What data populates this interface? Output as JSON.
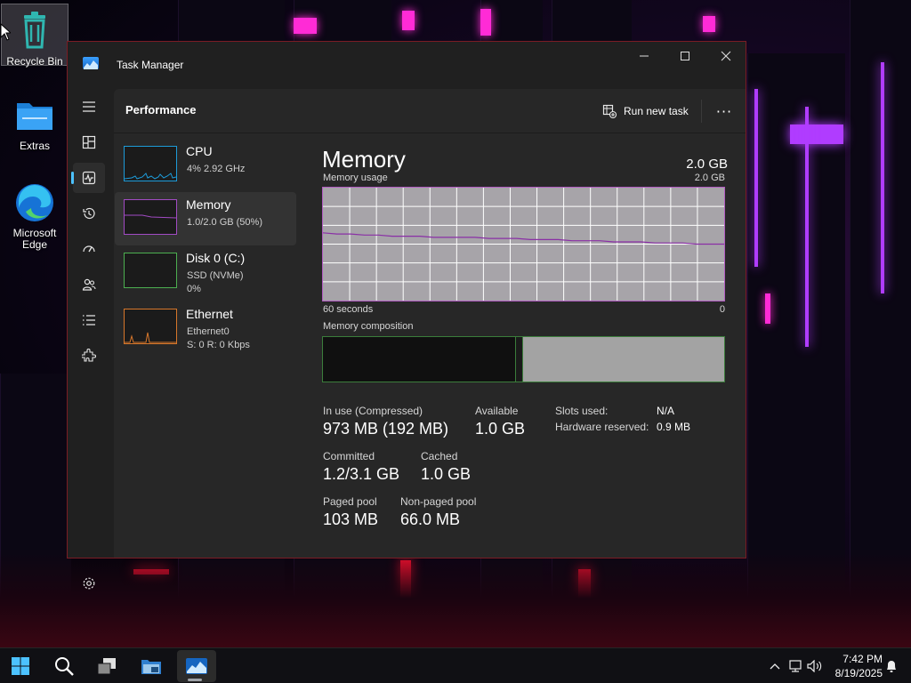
{
  "desktop": {
    "icons": [
      {
        "label": "Recycle Bin",
        "icon": "recycle-bin-icon"
      },
      {
        "label": "Extras",
        "icon": "folder-icon"
      },
      {
        "label": "Microsoft Edge",
        "icon": "edge-icon"
      }
    ]
  },
  "window": {
    "title": "Task Manager",
    "controls": {
      "minimize": "—",
      "maximize": "☐",
      "close": "✕"
    }
  },
  "header": {
    "page_title": "Performance",
    "run_new_task": "Run new task",
    "more": "···"
  },
  "rail": {
    "items": [
      "hamburger-icon",
      "processes-icon",
      "performance-icon",
      "app-history-icon",
      "startup-apps-icon",
      "users-icon",
      "details-icon",
      "services-icon"
    ],
    "active": "performance-icon",
    "settings": "settings-icon"
  },
  "perf_items": [
    {
      "name": "CPU",
      "sub1": "4% 2.92 GHz",
      "sub2": "",
      "color": "#1d9bd9"
    },
    {
      "name": "Memory",
      "sub1": "1.0/2.0 GB (50%)",
      "sub2": "",
      "color": "#a24bc4"
    },
    {
      "name": "Disk 0 (C:)",
      "sub1": "SSD (NVMe)",
      "sub2": "0%",
      "color": "#4caf50"
    },
    {
      "name": "Ethernet",
      "sub1": "Ethernet0",
      "sub2": "S: 0 R: 0 Kbps",
      "color": "#d7772b"
    }
  ],
  "memory": {
    "title": "Memory",
    "total": "2.0 GB",
    "usage_label": "Memory usage",
    "usage_max": "2.0 GB",
    "x_left": "60 seconds",
    "x_right": "0",
    "composition_label": "Memory composition",
    "usage_history_percent": [
      60,
      59,
      59,
      58,
      58,
      57,
      57,
      57,
      56,
      56,
      56,
      56,
      55,
      55,
      55,
      54,
      54,
      54,
      53,
      53,
      53,
      52,
      52,
      52,
      51,
      51,
      51,
      50,
      50,
      50
    ],
    "composition": {
      "in_use_fraction": 0.478,
      "modified_fraction": 0.02
    },
    "stats": {
      "in_use_label": "In use (Compressed)",
      "in_use": "973 MB (192 MB)",
      "available_label": "Available",
      "available": "1.0 GB",
      "committed_label": "Committed",
      "committed": "1.2/3.1 GB",
      "cached_label": "Cached",
      "cached": "1.0 GB",
      "paged_label": "Paged pool",
      "paged": "103 MB",
      "nonpaged_label": "Non-paged pool",
      "nonpaged": "66.0 MB",
      "slots_label": "Slots used:",
      "slots": "N/A",
      "hw_label": "Hardware reserved:",
      "hw": "0.9 MB"
    }
  },
  "taskbar": {
    "buttons": [
      "start-icon",
      "search-icon",
      "task-view-icon",
      "file-explorer-icon",
      "task-manager-icon"
    ],
    "active": "task-manager-icon",
    "time": "7:42 PM",
    "date": "8/19/2025"
  }
}
